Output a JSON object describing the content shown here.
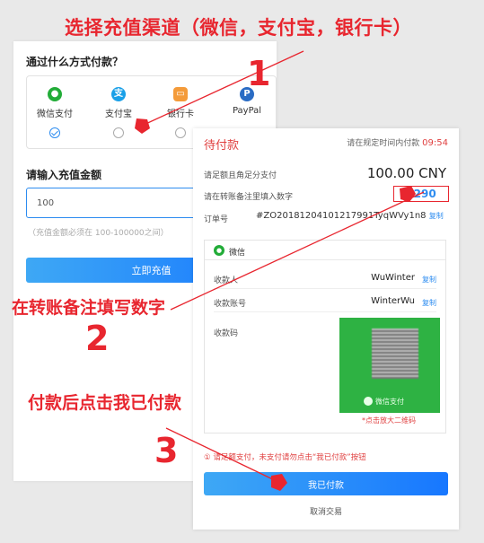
{
  "annotations": {
    "banner": "选择充值渠道（微信，支付宝，银行卡）",
    "step1_number": "1",
    "step2_text": "在转账备注填写数字",
    "step2_number": "2",
    "step3_text": "付款后点击我已付款",
    "step3_number": "3",
    "accent_color": "#e8262f"
  },
  "recharge": {
    "title": "通过什么方式付款？",
    "methods": [
      {
        "label": "微信支付",
        "icon": "wechat-icon",
        "color": "#22ac38",
        "checked": true
      },
      {
        "label": "支付宝",
        "icon": "alipay-icon",
        "color": "#1aa0e8",
        "checked": false
      },
      {
        "label": "银行卡",
        "icon": "bank-card-icon",
        "color": "#f49b3a",
        "checked": false
      },
      {
        "label": "PayPal",
        "icon": "paypal-icon",
        "color": "#2a6cc4",
        "checked": false
      }
    ],
    "amount_label": "请输入充值金额",
    "amount_value": "100",
    "amount_hint": "（充值金额必须在 100-100000之间）",
    "submit_label": "立即充值"
  },
  "payment": {
    "title": "待付款",
    "timer_text": "请在规定时间内付款",
    "timer_value": "09:54",
    "amount_label": "请足额且角足分支付",
    "amount_value": "100.00 CNY",
    "remark_label": "请在转账备注里填入数字",
    "remark_code": "2290",
    "order_label": "订单号",
    "order_no": "#ZO20181204101217991TyqWVy1n8",
    "copy_label": "复制",
    "wechat": {
      "name": "微信",
      "payee_label": "收款人",
      "payee_value": "WuWinter",
      "account_label": "收款账号",
      "account_value": "WinterWu",
      "qr_label": "收款码",
      "qr_caption": "微信支付",
      "qr_hint": "*点击放大二维码"
    },
    "notice": "① 请足额支付，未支付请勿点击“我已付款”按钮",
    "paid_button": "我已付款",
    "cancel_link": "取消交易"
  }
}
